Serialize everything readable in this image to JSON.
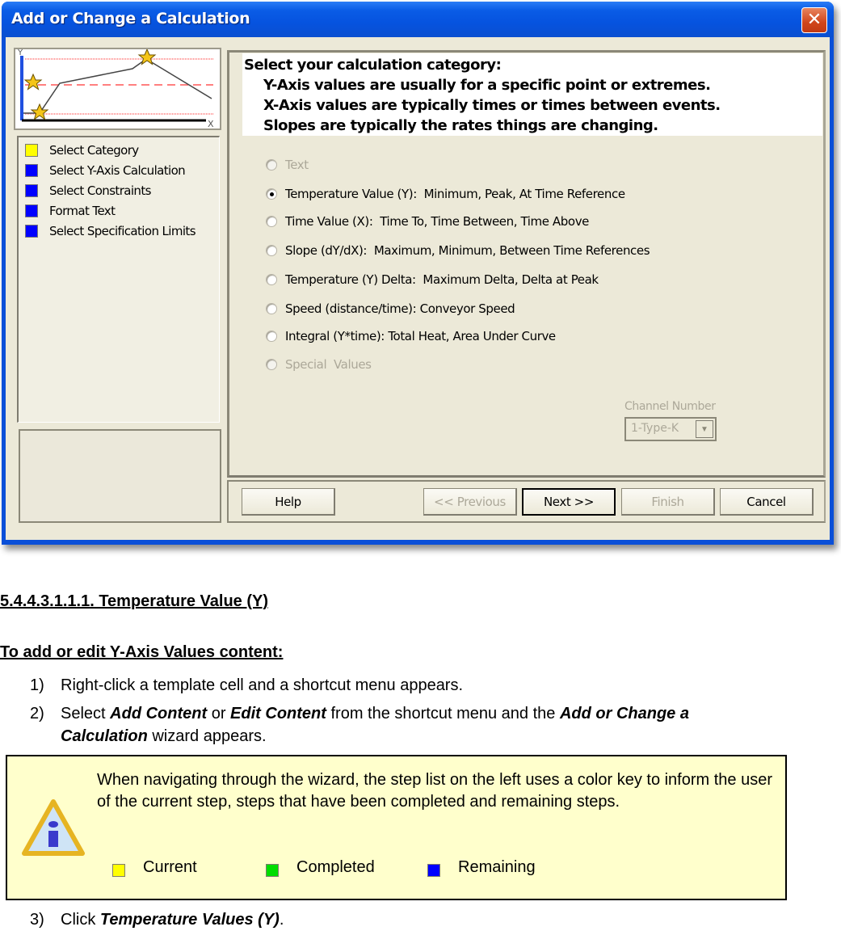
{
  "window": {
    "title": "Add or Change a Calculation",
    "close_icon": "close-x-icon"
  },
  "preview": {
    "y_axis_label": "Y",
    "x_axis_label": "X",
    "icon": "star-icon"
  },
  "steps": [
    {
      "label": "Select Category",
      "status": "current",
      "color": "#ffff00"
    },
    {
      "label": "Select Y-Axis Calculation",
      "status": "remaining",
      "color": "#0000ff"
    },
    {
      "label": "Select Constraints",
      "status": "remaining",
      "color": "#0000ff"
    },
    {
      "label": "Format Text",
      "status": "remaining",
      "color": "#0000ff"
    },
    {
      "label": "Select Specification Limits",
      "status": "remaining",
      "color": "#0000ff"
    }
  ],
  "header": {
    "title": "Select your calculation category:",
    "lines": [
      "Y-Axis values are usually for a specific point or extremes.",
      "X-Axis values are typically times or times between events.",
      "Slopes are typically the rates things are changing."
    ]
  },
  "categories": [
    {
      "label": "Text",
      "enabled": false,
      "checked": false
    },
    {
      "label": "Temperature Value (Y):  Minimum, Peak, At Time Reference",
      "enabled": true,
      "checked": true
    },
    {
      "label": "Time Value (X):  Time To, Time Between, Time Above",
      "enabled": true,
      "checked": false
    },
    {
      "label": "Slope (dY/dX):  Maximum, Minimum, Between Time References",
      "enabled": true,
      "checked": false
    },
    {
      "label": "Temperature (Y) Delta:  Maximum Delta, Delta at Peak",
      "enabled": true,
      "checked": false
    },
    {
      "label": "Speed (distance/time): Conveyor Speed",
      "enabled": true,
      "checked": false
    },
    {
      "label": "Integral (Y*time): Total Heat, Area Under Curve",
      "enabled": true,
      "checked": false
    },
    {
      "label": "Special  Values",
      "enabled": false,
      "checked": false
    }
  ],
  "channel": {
    "label": "Channel Number",
    "value": "1-Type-K",
    "enabled": false
  },
  "buttons": {
    "help": "Help",
    "previous": "<< Previous",
    "next": "Next >>",
    "finish": "Finish",
    "cancel": "Cancel"
  },
  "document": {
    "heading": "5.4.4.3.1.1.1. Temperature Value (Y)",
    "subheading": "To add or edit Y-Axis Values content:",
    "steps": [
      {
        "num": "1)",
        "parts": [
          {
            "text": "Right-click a template cell and a shortcut menu appears.",
            "emph": false
          }
        ]
      },
      {
        "num": "2)",
        "parts": [
          {
            "text": "Select ",
            "emph": false
          },
          {
            "text": "Add Content",
            "emph": true
          },
          {
            "text": " or ",
            "emph": false
          },
          {
            "text": "Edit Content",
            "emph": true
          },
          {
            "text": " from the shortcut menu and the ",
            "emph": false
          },
          {
            "text": "Add or Change a Calculation",
            "emph": true
          },
          {
            "text": " wizard appears.",
            "emph": false
          }
        ]
      },
      {
        "num": "3)",
        "parts": [
          {
            "text": "Click ",
            "emph": false
          },
          {
            "text": "Temperature Values (Y)",
            "emph": true
          },
          {
            "text": ".",
            "emph": false
          }
        ]
      }
    ],
    "note": {
      "icon": "info-icon",
      "text": "When navigating through the wizard, the step list on the left uses a color key to inform the user of the current step, steps that have been completed and remaining steps.",
      "legend": [
        {
          "label": "Current",
          "color": "#ffff00"
        },
        {
          "label": "Completed",
          "color": "#00dd00"
        },
        {
          "label": "Remaining",
          "color": "#0000ff"
        }
      ]
    }
  }
}
